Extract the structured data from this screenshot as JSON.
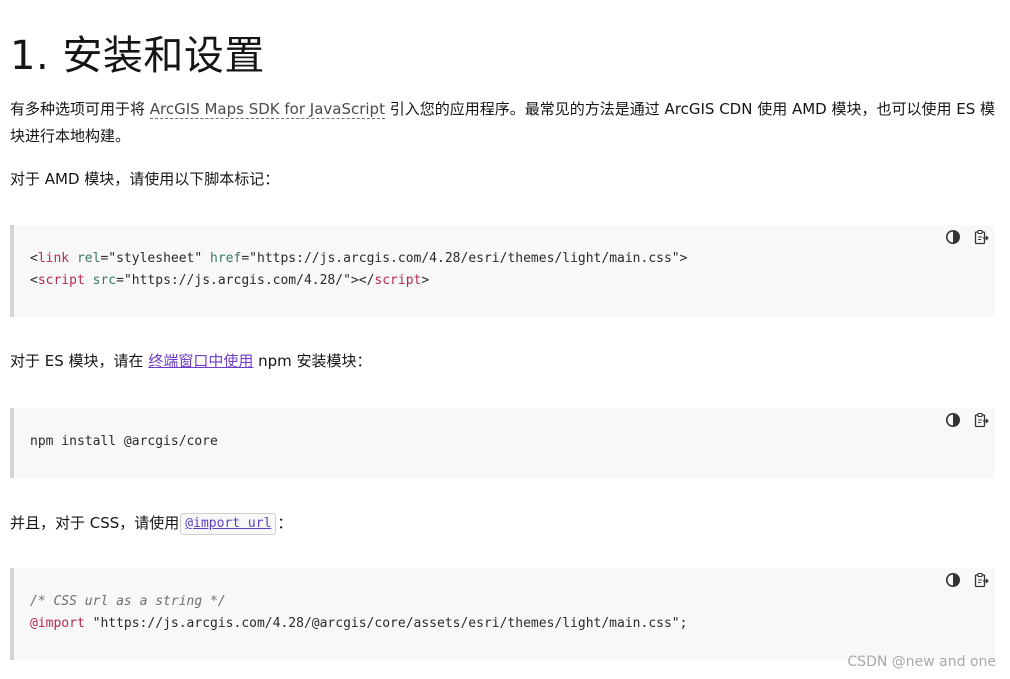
{
  "heading": "1. 安装和设置",
  "intro": {
    "before": "有多种选项可用于将 ",
    "term": "ArcGIS Maps SDK for JavaScript",
    "after": " 引入您的应用程序。最常见的方法是通过 ArcGIS CDN 使用 AMD 模块，也可以使用 ES 模块进行本地构建。"
  },
  "amd_text": "对于 AMD 模块，请使用以下脚本标记：",
  "code_amd": {
    "line1": {
      "lt": "<",
      "tag": "link",
      "sp1": " ",
      "attr1": "rel",
      "eq1": "=",
      "val1": "\"stylesheet\"",
      "sp2": " ",
      "attr2": "href",
      "eq2": "=",
      "val2": "\"https://js.arcgis.com/4.28/esri/themes/light/main.css\"",
      "gt": ">"
    },
    "line2": {
      "lt": "<",
      "tag": "script",
      "sp1": " ",
      "attr1": "src",
      "eq1": "=",
      "val1": "\"https://js.arcgis.com/4.28/\"",
      "close": "></",
      "tag2": "script",
      "gt": ">"
    }
  },
  "es_text": {
    "before": "对于 ES 模块，请在 ",
    "link": "终端窗口中使用",
    "after": " npm 安装模块："
  },
  "code_es": "npm install @arcgis/core",
  "css_text": {
    "before": "并且，对于 CSS，请使用",
    "code_link": "@import url",
    "after": "："
  },
  "code_css": {
    "comment": "/* CSS url as a string */",
    "at": "@import",
    "rest": " \"https://js.arcgis.com/4.28/@arcgis/core/assets/esri/themes/light/main.css\";"
  },
  "icons": {
    "theme": "contrast-icon",
    "copy": "copy-clipboard-icon"
  },
  "watermark": "CSDN @new  and one"
}
